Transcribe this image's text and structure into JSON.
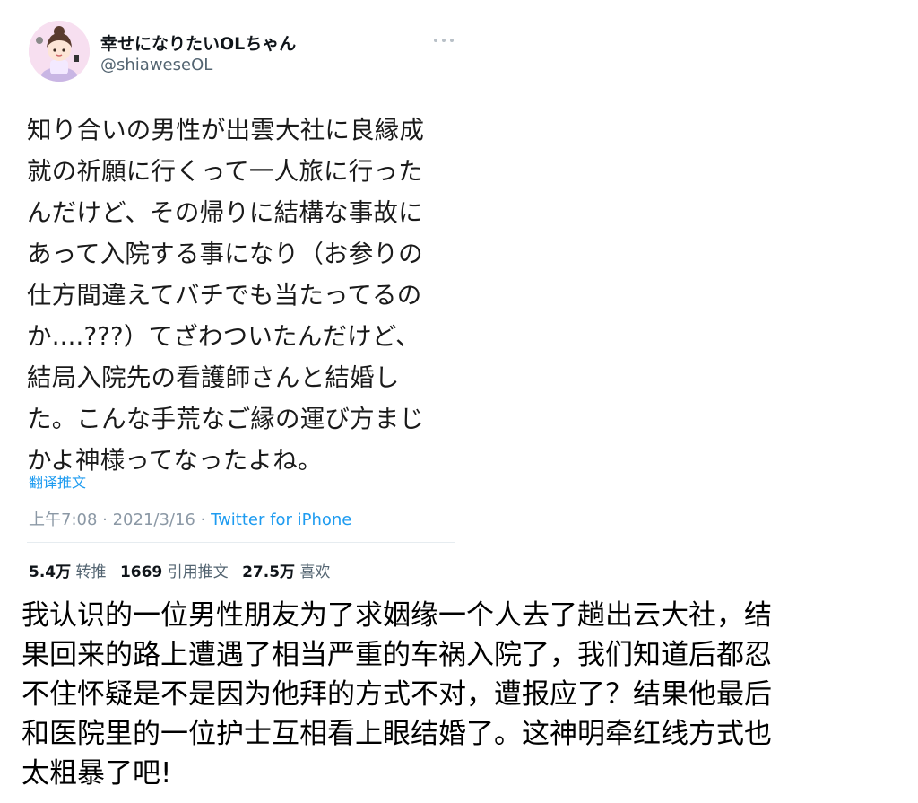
{
  "tweet": {
    "display_name": "幸せになりたいOLちゃん",
    "handle": "@shiaweseOL",
    "text_lines": [
      "知り合いの男性が出雲大社に良縁成",
      "就の祈願に行くって一人旅に行った",
      "んだけど、その帰りに結構な事故に",
      "あって入院する事になり（お参りの",
      "仕方間違えてバチでも当たってるの",
      "か....???）てざわついたんだけど、",
      "結局入院先の看護師さんと結婚し",
      "た。こんな手荒なご縁の運び方まじ",
      "かよ神様ってなったよね。"
    ],
    "translate_label": "翻译推文",
    "time": "上午7:08",
    "separator": " · ",
    "date": "2021/3/16",
    "source": "Twitter for iPhone",
    "stats": {
      "retweets_count": "5.4万",
      "retweets_label": "转推",
      "quotes_count": "1669",
      "quotes_label": "引用推文",
      "likes_count": "27.5万",
      "likes_label": "喜欢"
    },
    "more_icon": "more-horizontal-icon",
    "avatar_icon": "avatar-illustration"
  },
  "caption": {
    "lines": [
      "我认识的一位男性朋友为了求姻缘一个人去了趟出云大社，结",
      "果回来的路上遭遇了相当严重的车祸入院了，我们知道后都忍",
      "不住怀疑是不是因为他拜的方式不对，遭报应了？结果他最后",
      "和医院里的一位护士互相看上眼结婚了。这神明牵红线方式也",
      "太粗暴了吧!"
    ]
  },
  "colors": {
    "link": "#1d9bf0",
    "meta": "#8b98a5",
    "avatar_bg": "#f7dff0"
  }
}
